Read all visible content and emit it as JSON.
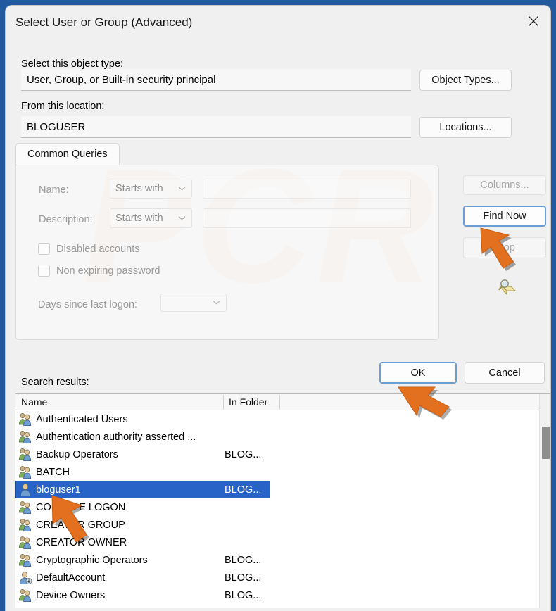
{
  "window": {
    "title": "Select User or Group (Advanced)",
    "close_icon": "close-icon",
    "backdrop_color": "#215a9e"
  },
  "object_type": {
    "label": "Select this object type:",
    "value": "User, Group, or Built-in security principal",
    "button_label": "Object Types..."
  },
  "location": {
    "label": "From this location:",
    "value": "BLOGUSER",
    "button_label": "Locations..."
  },
  "tabs": [
    {
      "label": "Common Queries",
      "active": true
    }
  ],
  "query_form": {
    "name_label": "Name:",
    "name_operator": "Starts with",
    "name_value": "",
    "description_label": "Description:",
    "description_operator": "Starts with",
    "description_value": "",
    "disabled_accounts_label": "Disabled accounts",
    "disabled_accounts_checked": false,
    "non_expiring_password_label": "Non expiring password",
    "non_expiring_password_checked": false,
    "days_since_logon_label": "Days since last logon:",
    "days_since_logon_value": "",
    "search_icon": "magnifier-folder-icon"
  },
  "side_buttons": {
    "columns_label": "Columns...",
    "columns_disabled": true,
    "find_now_label": "Find Now",
    "find_now_focused": true,
    "stop_label": "Stop",
    "stop_disabled": true
  },
  "dialog_buttons": {
    "ok_label": "OK",
    "ok_focused": true,
    "cancel_label": "Cancel"
  },
  "results": {
    "label": "Search results:",
    "columns": [
      "Name",
      "In Folder"
    ],
    "selected_index": 4,
    "rows": [
      {
        "icon": "group-icon",
        "name": "Authenticated Users",
        "folder": ""
      },
      {
        "icon": "group-icon",
        "name": "Authentication authority asserted ...",
        "folder": ""
      },
      {
        "icon": "group-icon",
        "name": "Backup Operators",
        "folder": "BLOG..."
      },
      {
        "icon": "group-icon",
        "name": "BATCH",
        "folder": ""
      },
      {
        "icon": "user-icon",
        "name": "bloguser1",
        "folder": "BLOG..."
      },
      {
        "icon": "group-icon",
        "name": "CONSOLE LOGON",
        "folder": ""
      },
      {
        "icon": "group-icon",
        "name": "CREATOR GROUP",
        "folder": ""
      },
      {
        "icon": "group-icon",
        "name": "CREATOR OWNER",
        "folder": ""
      },
      {
        "icon": "group-icon",
        "name": "Cryptographic Operators",
        "folder": "BLOG..."
      },
      {
        "icon": "user-badge-icon",
        "name": "DefaultAccount",
        "folder": "BLOG..."
      },
      {
        "icon": "group-icon",
        "name": "Device Owners",
        "folder": "BLOG..."
      }
    ]
  },
  "annotations": {
    "arrow_color": "#e2701e",
    "arrows": [
      "arrow-find-now",
      "arrow-ok",
      "arrow-selected-row"
    ]
  }
}
